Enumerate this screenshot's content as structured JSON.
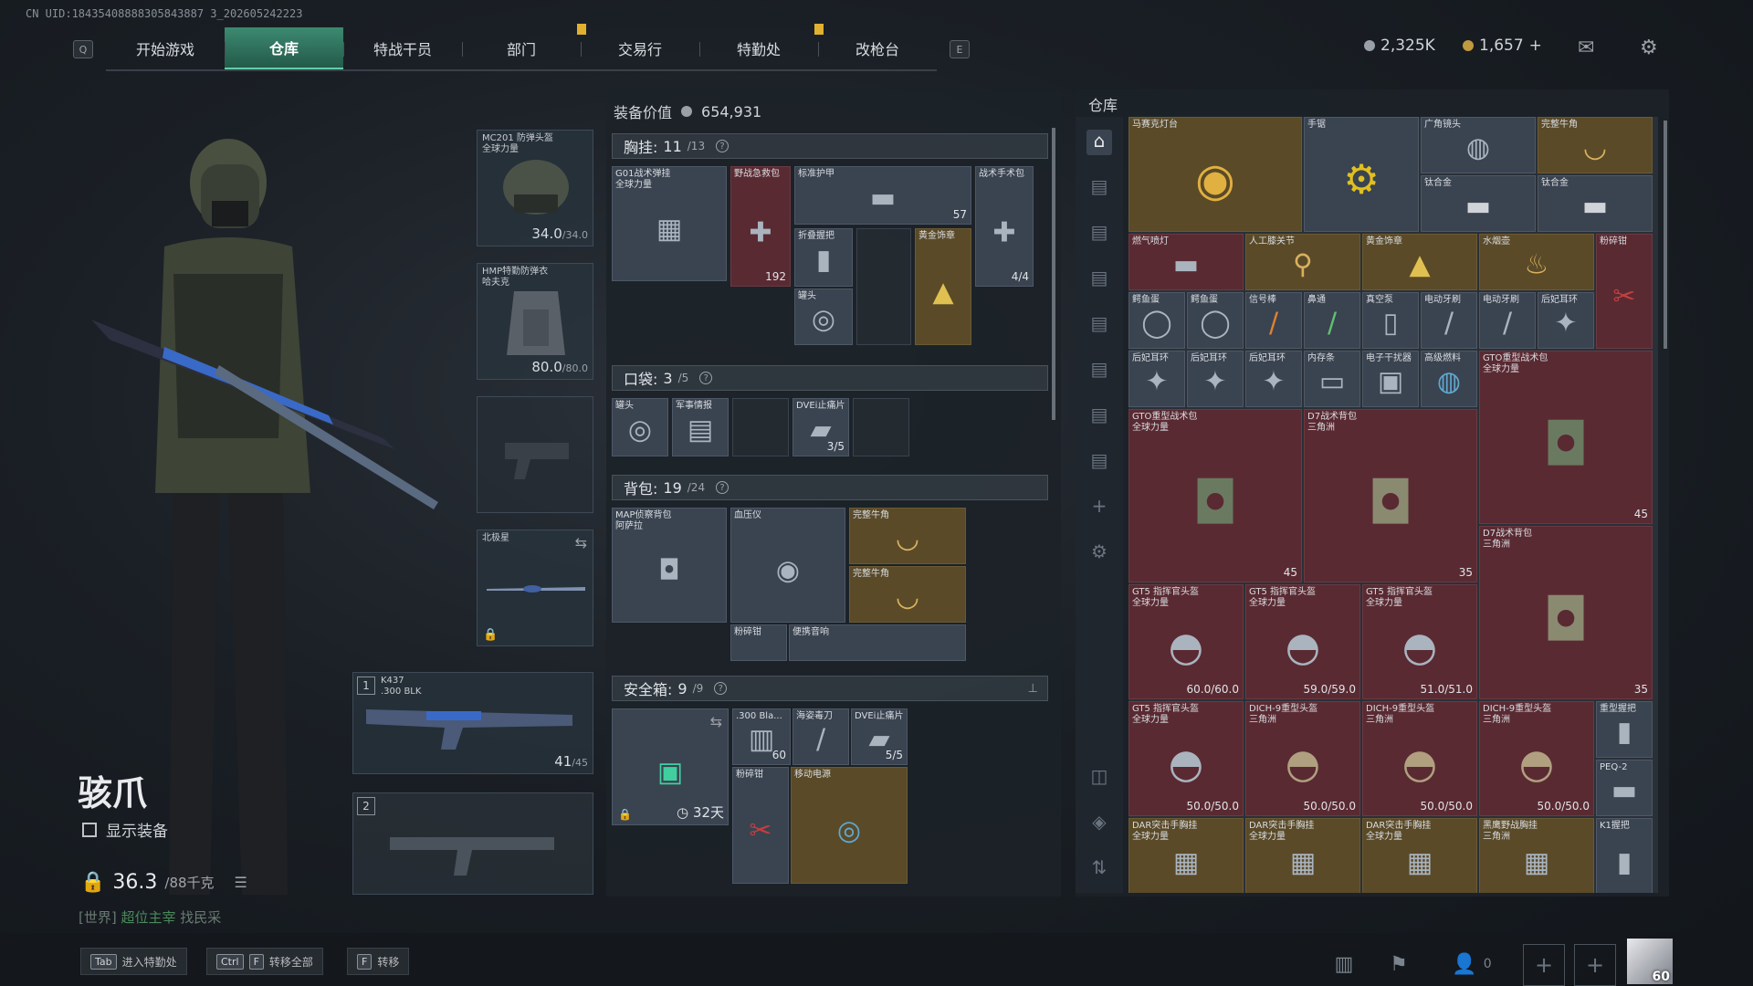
{
  "uid": "CN UID:18435408888305843887 3_202605242223",
  "nav": {
    "left_key": "Q",
    "right_key": "E",
    "tabs": [
      "开始游戏",
      "仓库",
      "特战干员",
      "部门",
      "交易行",
      "特勤处",
      "改枪台"
    ],
    "active_tab": "仓库"
  },
  "currency": {
    "silver": "2,325K",
    "gold": "1,657",
    "gold_plus": "+"
  },
  "character": {
    "name": "骇爪",
    "show_equipment": "显示装备",
    "weight_value": "36.3",
    "weight_max": "/88千克",
    "world_chat_tag": "[世界]",
    "world_chat_user": "超位主宰",
    "world_chat_msg": "找民采"
  },
  "equipment": {
    "helmet": {
      "name": "MC201 防弹头盔",
      "sub": "全球力量",
      "value": "34.0",
      "max": "/34.0"
    },
    "armor": {
      "name": "HMP特勤防弹衣",
      "sub": "哈夫克",
      "value": "80.0",
      "max": "/80.0"
    },
    "melee": {
      "name": "北极星"
    },
    "primary": {
      "slot": "1",
      "name": "K437",
      "sub": ".300 BLK",
      "ammo": "41",
      "ammo_max": "/45"
    },
    "secondary": {
      "slot": "2"
    }
  },
  "loadout": {
    "value_label": "装备价值",
    "value": "654,931",
    "chest": {
      "title": "胸挂:",
      "count": "11",
      "max": "/13"
    },
    "pocket": {
      "title": "口袋:",
      "count": "3",
      "max": "/5"
    },
    "backpack": {
      "title": "背包:",
      "count": "19",
      "max": "/24"
    },
    "safebox": {
      "title": "安全箱:",
      "count": "9",
      "max": "/9",
      "days": "32天"
    },
    "chest_items": [
      {
        "name": "G01战术弹挂",
        "sub": "全球力量"
      },
      {
        "name": "野战急救包",
        "qty": "192"
      },
      {
        "name": "标准护甲",
        "qty": "57"
      },
      {
        "name": "战术手术包",
        "qty": "4/4"
      },
      {
        "name": "折叠握把"
      },
      {
        "name": "罐头"
      },
      {
        "name": "黄金饰章"
      }
    ],
    "pocket_items": [
      {
        "name": "罐头"
      },
      {
        "name": "军事情报"
      },
      {
        "name": "DVEi止痛片",
        "qty": "3/5"
      }
    ],
    "backpack_items": [
      {
        "name": "MAP侦察背包",
        "sub": "阿萨拉"
      },
      {
        "name": "血压仪"
      },
      {
        "name": "完整牛角"
      },
      {
        "name": "完整牛角"
      },
      {
        "name": "粉碎钳"
      },
      {
        "name": "便携音响"
      }
    ],
    "safebox_items": [
      {
        "name": ".300 Bla...",
        "qty": "60"
      },
      {
        "name": "海姿毒刀"
      },
      {
        "name": "DVEi止痛片",
        "qty": "5/5"
      },
      {
        "name": "粉碎钳"
      },
      {
        "name": "移动电源"
      }
    ]
  },
  "warehouse": {
    "title": "仓库",
    "items": [
      {
        "name": "马赛克灯台"
      },
      {
        "name": "手锯"
      },
      {
        "name": "广角镜头"
      },
      {
        "name": "完整牛角"
      },
      {
        "name": "钛合金"
      },
      {
        "name": "钛合金"
      },
      {
        "name": "燃气喷灯"
      },
      {
        "name": "人工膝关节"
      },
      {
        "name": "黄金饰章"
      },
      {
        "name": "水烟壶"
      },
      {
        "name": "粉碎钳"
      },
      {
        "name": "鳄鱼蛋"
      },
      {
        "name": "鳄鱼蛋"
      },
      {
        "name": "信号棒"
      },
      {
        "name": "鼻通"
      },
      {
        "name": "真空泵"
      },
      {
        "name": "电动牙刷"
      },
      {
        "name": "电动牙刷"
      },
      {
        "name": "后妃耳环"
      },
      {
        "name": "后妃耳环"
      },
      {
        "name": "后妃耳环"
      },
      {
        "name": "后妃耳环"
      },
      {
        "name": "内存条"
      },
      {
        "name": "电子干扰器"
      },
      {
        "name": "高级燃料"
      },
      {
        "name": "GTO重型战术包",
        "sub": "全球力量",
        "qty": "45"
      },
      {
        "name": "GTO重型战术包",
        "sub": "全球力量",
        "qty": "45"
      },
      {
        "name": "D7战术背包",
        "sub": "三角洲",
        "qty": "35"
      },
      {
        "name": "D7战术背包",
        "sub": "三角洲",
        "qty": "35"
      },
      {
        "name": "GT5 指挥官头盔",
        "sub": "全球力量",
        "qty": "60.0/60.0"
      },
      {
        "name": "GT5 指挥官头盔",
        "sub": "全球力量",
        "qty": "59.0/59.0"
      },
      {
        "name": "GT5 指挥官头盔",
        "sub": "全球力量",
        "qty": "51.0/51.0"
      },
      {
        "name": "GT5 指挥官头盔",
        "sub": "全球力量",
        "qty": "50.0/50.0"
      },
      {
        "name": "DICH-9重型头盔",
        "sub": "三角洲",
        "qty": "50.0/50.0"
      },
      {
        "name": "DICH-9重型头盔",
        "sub": "三角洲",
        "qty": "50.0/50.0"
      },
      {
        "name": "DICH-9重型头盔",
        "sub": "三角洲",
        "qty": "50.0/50.0"
      },
      {
        "name": "重型握把"
      },
      {
        "name": "PEQ-2"
      },
      {
        "name": "DAR突击手胸挂",
        "sub": "全球力量"
      },
      {
        "name": "DAR突击手胸挂",
        "sub": "全球力量"
      },
      {
        "name": "DAR突击手胸挂",
        "sub": "全球力量"
      },
      {
        "name": "黑鹰野战胸挂",
        "sub": "三角洲"
      },
      {
        "name": "K1握把"
      }
    ]
  },
  "bottom": {
    "hint1_key": "Tab",
    "hint1": "进入特勤处",
    "hint2_key1": "Ctrl",
    "hint2_key2": "F",
    "hint2": "转移全部",
    "hint3_key": "F",
    "hint3": "转移",
    "friends_count": "0",
    "level": "60"
  }
}
